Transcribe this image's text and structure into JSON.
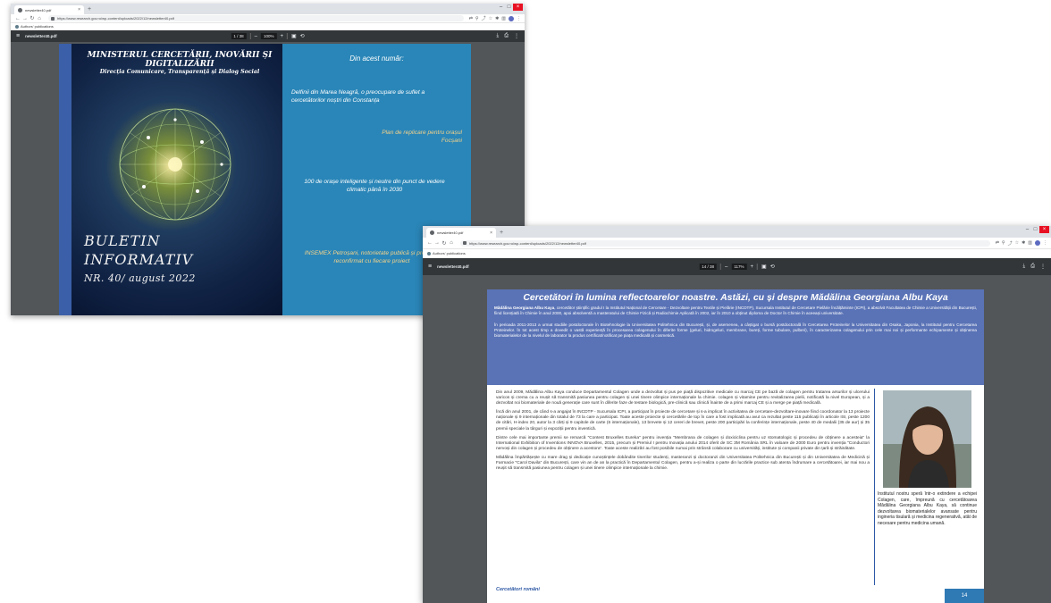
{
  "window1": {
    "tab_title": "newsletter40.pdf",
    "url": "https://www.research.gov.ro/wp-content/uploads/2022/12/newsletter40.pdf",
    "bookmark": "Authors' publications",
    "pdf_filename": "newsletter40.pdf",
    "page_indicator": "1 / 38",
    "zoom": "100%",
    "cover": {
      "ministry_line1": "MINISTERUL CERCETĂRII, INOVĂRII ȘI",
      "ministry_line2": "DIGITALIZĂRII",
      "direction": "Direcția Comunicare, Transparență și Dialog Social",
      "buletin_line1": "BULETIN",
      "buletin_line2": "INFORMATIV",
      "issue": "NR. 40/ august 2022",
      "contents_title": "Din acest număr:",
      "item1": "Delfinii din Marea Neagră, o preocupare de suflet a cercetătorilor noștri din Constanța",
      "item2": "Plan de replicare pentru orașul Focșani",
      "item3": "100 de orașe inteligente și neutre din punct de vedere climatic până în 2030",
      "item4": "INSEMEX Petroșani, notorietate publică și prestigiu reconfirmat cu fiecare proiect"
    }
  },
  "window2": {
    "tab_title": "newsletter40.pdf",
    "url": "https://www.research.gov.ro/wp-content/uploads/2022/12/newsletter40.pdf",
    "bookmark": "Authors' publications",
    "pdf_filename": "newsletter40.pdf",
    "page_indicator": "14 / 38",
    "zoom": "117%",
    "article": {
      "title": "Cercetători în lumina reflectoarelor noastre. Astăzi, cu și despre Mădălina Georgiana Albu Kaya",
      "intro_name": "Mădălina Georgiana Albu Kaya",
      "intro_rest": ", cercetător științific gradul I la Institutul Național de Cercetare - Dezvoltare pentru Textile și Pielărie (INCDTP), Sucursala Institutul de Cercetare Pielărie Încălțăminte (ICPI), a absolvit Facultatea de Chimie a Universității din București, fiind licențiată în Chimie în anul 2000, apoi absolventă a masteratului de Chimie Fizică și Radiochimie Aplicată în 2002, iar în 2010 a obținut diploma de Doctor în Chimie în aceeași universitate.",
      "intro2": "În perioada 2011-2013 a urmat studiile postdoctorale în Biotehnologie la Universitatea Politehnica din București, și, de asemenea, a câștigat o bursă postdoctorală în Cercetarea Proteinelor la Universitatea din Osaka, Japonia, la Institutul pentru Cercetarea Proteinelor. În tot acest timp a dovedit o vastă experiență în procesarea colagenului în diferite forme (geluri, hidrogeluri, membrane, bureți, forme tubulare, pulberi), în caracterizarea colagenului prin cele mai noi și performante echipamente și obținerea biomaterialelor de la nivelul de laborator la produs certificat/notificat pe piața medicală și cosmetică.",
      "p1": "Din anul 2009, Mădălina Albu Kaya conduce Departamentul Colagen unde a dezvoltat și pus pe piață dispozitive medicale cu marcaj CE pe bază de colagen pentru tratarea arsurilor și ulcerului varicos și crema cu a reușit să transmită pasiunea pentru colagen și unei tinere olimpice internaționale la chimie. colagen și vitamine pentru revitalizarea pielii, notificată la nivel European, și a dezvoltat noi biomateriale de nouă generație care sunt în diferite faze de testare biologică, pre-clinică sau clinică înainte de a primi marcaj CE și a merge pe piață medicală.",
      "p2": "Încă din anul 2001, de când s-a angajat în INCDTP - Sucursala ICPI, a participat în proiecte de cercetare și s-a implicat în activitatea de cercetare-dezvoltare-inovare fiind coordonator la 13 proiecte naționale și 9 internaționale din totalul de 73 la care a participat. Toate aceste proiecte și cercetările de top în care a fost implicată au avut ca rezultat peste 115 publicații în articole ISI, peste 1200 de citări, H-index 20, autor la 3 cărți și 9 capitole de carte (6 internaționale), 13 brevete și 12 cereri de brevet, peste 200 participări la conferințe internaționale, peste 40 de medalii (35 de aur) și 35 premii speciale la târguri și expoziții pentru inventică.",
      "p3": "Dintre cele mai importante premii se remarcă \"Contest Bruxelles Eureka\" pentru invenția \"Membrana de colagen și doxiciclina pentru uz stomatologic și procedeu de obținere a acesteia\" la International Exhibition of Inventions INNOVA Bruxelles, 2015, precum și Premiul I pentru Inovația anului 2014 oferit de SC 3M România SRL în valoare de 2000 Euro pentru invenția \"Conductori nervoși din colagen și procedeu de obținere a acestora\". Toate aceste realizări au fost posibile numai prin strânsă colaborare cu universități, institute și companii private din țară și străinătate.",
      "p4": "Mădălina împărtășește cu mare drag și dedicație cunoștințele dobândite tinerilor studenți, masteranzi și doctoranzi din Universitatea Politehnica din București și din Universitatea de Medicină și Farmacie \"Carol Davila\" din București, care vin an de an la practică în Departamentul Colagen, pentru a-și realiza o parte din lucrările practice sub atenta îndrumare a cercetătoarei, iar mai nou a reușit să transmită pasiunea pentru colagen și unei tinere olimpice internaționale la chimie.",
      "footer": "Cercetători români",
      "sidebar": "Institutul nostru speră într-o extindere a echipei Colagen, care, împreună cu cercetătoarea Mădălina Georgiana Albu Kaya, să continue dezvoltarea biomaterialelor avansate pentru ingineria tisulară și medicina regenerativă, atât de necesare pentru medicina umană.",
      "page_number": "14"
    }
  },
  "colors": {
    "pdf_toolbar": "#323639",
    "pdf_background": "#525659",
    "cover_blue": "#2a86b8",
    "article_header": "#5a73b6",
    "accent_blue": "#2d58a5"
  }
}
